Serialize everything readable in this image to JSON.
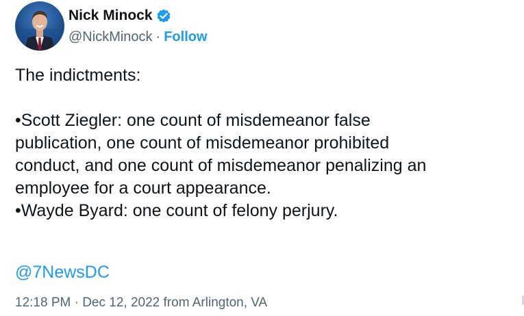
{
  "author": {
    "display_name": "Nick Minock",
    "handle": "@NickMinock",
    "separator": "·",
    "follow_label": "Follow",
    "verified_color": "#1d9bf0",
    "avatar_icon": "avatar-photo"
  },
  "tweet": {
    "lines": [
      "The indictments:",
      "",
      "•Scott Ziegler: one count of misdemeanor false",
      "publication, one count of misdemeanor prohibited",
      "conduct, and one count of misdemeanor penalizing an",
      "employee for a court appearance.",
      "•Wayde Byard: one count of felony perjury."
    ],
    "mention": "@7NewsDC",
    "timestamp": "12:18 PM · Dec 12, 2022 from Arlington, VA"
  },
  "colors": {
    "link": "#1d9bf0",
    "text": "#0f1419",
    "muted": "#536471"
  }
}
